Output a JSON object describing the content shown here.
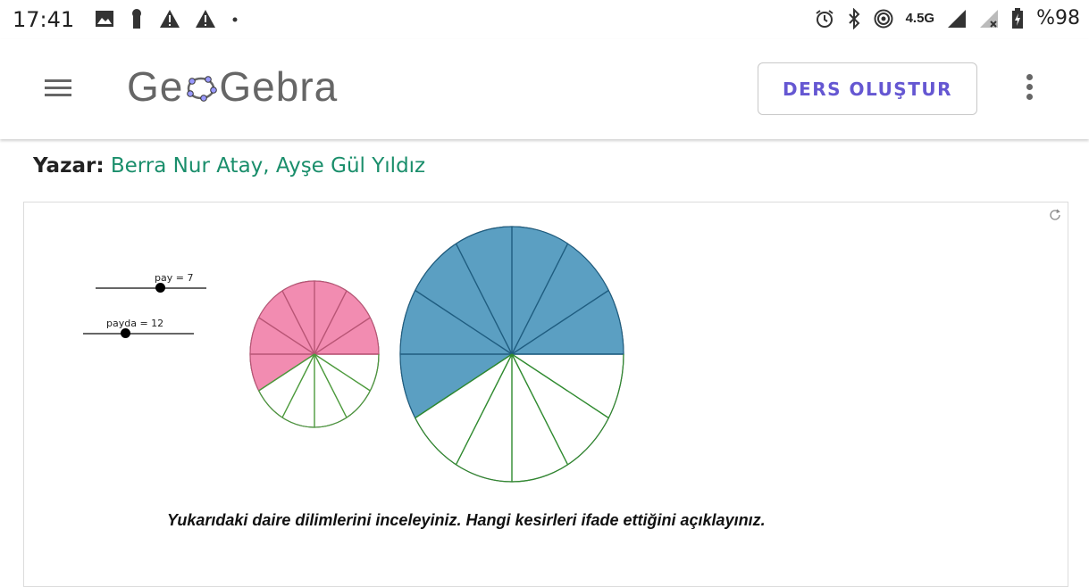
{
  "status_bar": {
    "time": "17:41",
    "left_icons": [
      "image-icon",
      "keyhole-icon",
      "warning-icon",
      "warning-icon",
      "dot-icon"
    ],
    "network": "4.5G",
    "battery": "%98"
  },
  "app_bar": {
    "logo_prefix": "Ge",
    "logo_suffix": "Gebra",
    "create_button_label": "DERS OLUŞTUR"
  },
  "author": {
    "label": "Yazar:",
    "names": [
      "Berra Nur Atay",
      "Ayşe Gül Yıldız"
    ],
    "separator": ","
  },
  "applet": {
    "slider_pay": {
      "label": "pay = 7",
      "value": 7,
      "min": 0,
      "max": 12
    },
    "slider_payda": {
      "label": "payda = 12",
      "value": 12,
      "min": 1,
      "max": 30
    },
    "small_circle": {
      "divisions": 12,
      "filled": 7,
      "fill_color": "#f28cb1",
      "edge_color": "#b85575",
      "line_color": "#4c9a3c"
    },
    "large_circle": {
      "divisions": 12,
      "filled": 7,
      "fill_color": "#5b9fc2",
      "edge_color": "#1f5d80",
      "line_color": "#2f8a2f"
    },
    "caption": "Yukarıdaki daire dilimlerini inceleyiniz. Hangi kesirleri ifade ettiğini açıklayınız."
  },
  "colors": {
    "accent": "#6557d2",
    "author_link": "#1a8e6b"
  }
}
